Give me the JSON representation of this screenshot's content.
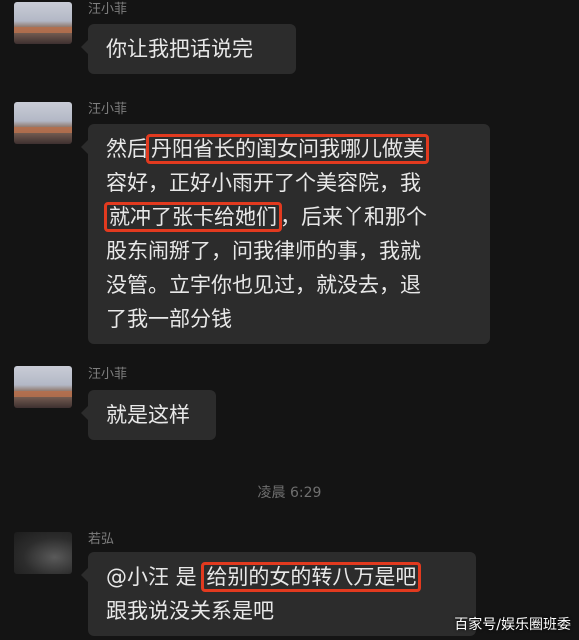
{
  "messages": [
    {
      "sender": "汪小菲",
      "lines": [
        [
          {
            "text": "你让我把话说完",
            "hl": false
          }
        ]
      ]
    },
    {
      "sender": "汪小菲",
      "lines": [
        [
          {
            "text": "然后",
            "hl": false
          },
          {
            "text": "丹阳省长的闺女问我哪儿做美",
            "hl": true
          }
        ],
        [
          {
            "text": "容好，正好小雨开了个美容院，我",
            "hl": false
          }
        ],
        [
          {
            "text": "就冲了张卡给她们",
            "hl": true
          },
          {
            "text": "，后来丫和那个",
            "hl": false
          }
        ],
        [
          {
            "text": "股东闹掰了，问我律师的事，我就",
            "hl": false
          }
        ],
        [
          {
            "text": "没管。立宇你也见过，就没去，退",
            "hl": false
          }
        ],
        [
          {
            "text": "了我一部分钱",
            "hl": false
          }
        ]
      ]
    },
    {
      "sender": "汪小菲",
      "lines": [
        [
          {
            "text": "就是这样",
            "hl": false
          }
        ]
      ]
    },
    {
      "sender": "若弘",
      "lines": [
        [
          {
            "text": "@小汪 是 ",
            "hl": false
          },
          {
            "text": "给别的女的转八万是吧",
            "hl": true
          }
        ],
        [
          {
            "text": "跟我说没关系是吧",
            "hl": false
          }
        ]
      ]
    }
  ],
  "timestamp": "凌晨 6:29",
  "watermark": "百家号/娱乐圈班委",
  "colors": {
    "background": "#141414",
    "bubble": "#2c2c2c",
    "highlight_border": "#e23a1f",
    "text": "#e8e8e8"
  }
}
